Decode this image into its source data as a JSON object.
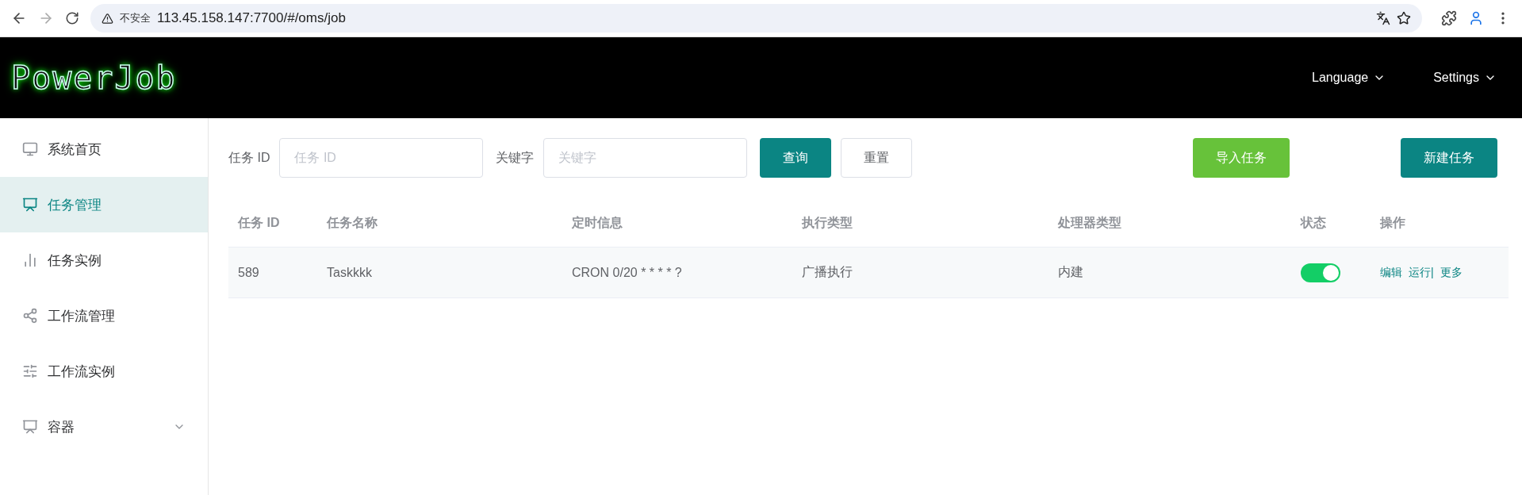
{
  "browser": {
    "security": "不安全",
    "url": "113.45.158.147:7700/#/oms/job"
  },
  "header": {
    "logo": "PowerJob",
    "menus": [
      "Language",
      "Settings"
    ]
  },
  "sidebar": {
    "items": [
      {
        "label": "系统首页",
        "selected": false,
        "expandable": false
      },
      {
        "label": "任务管理",
        "selected": true,
        "expandable": false
      },
      {
        "label": "任务实例",
        "selected": false,
        "expandable": false
      },
      {
        "label": "工作流管理",
        "selected": false,
        "expandable": false
      },
      {
        "label": "工作流实例",
        "selected": false,
        "expandable": false
      },
      {
        "label": "容器",
        "selected": false,
        "expandable": true
      }
    ]
  },
  "filters": [
    {
      "label": "任务 ID",
      "placeholder": "任务 ID"
    },
    {
      "label": "关键字",
      "placeholder": "关键字"
    }
  ],
  "buttons": [
    {
      "label": "查询",
      "kind": "primary"
    },
    {
      "label": "重置",
      "kind": "plain"
    }
  ],
  "right_buttons": [
    {
      "label": "导入任务",
      "kind": "success"
    },
    {
      "label": "新建任务",
      "kind": "primary"
    }
  ],
  "table": {
    "columns": [
      "任务 ID",
      "任务名称",
      "定时信息",
      "执行类型",
      "处理器类型",
      "状态",
      "操作"
    ],
    "rows": [
      {
        "id": "589",
        "name": "Taskkkk",
        "schedule": "CRON 0/20 * * * * ?",
        "exec_type": "广播执行",
        "processor": "内建",
        "enabled": true,
        "actions": [
          "编辑",
          "运行|",
          "更多"
        ]
      }
    ]
  }
}
